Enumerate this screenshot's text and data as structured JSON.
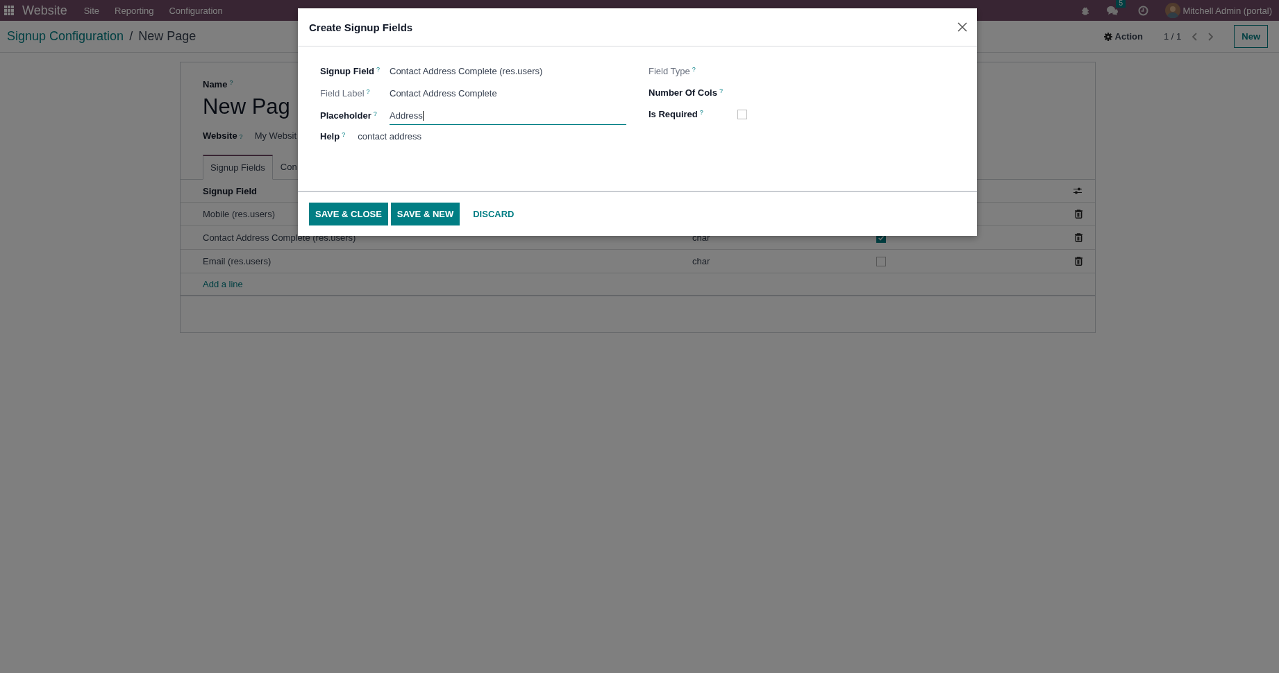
{
  "nav": {
    "app": "Website",
    "menus": [
      "Site",
      "Reporting",
      "Configuration"
    ],
    "message_count": "5",
    "user": "Mitchell Admin (portal)"
  },
  "breadcrumb": {
    "parent": "Signup Configuration",
    "separator": "/",
    "current": "New Page"
  },
  "control": {
    "action": "Action",
    "pager": "1 / 1",
    "new_label": "New"
  },
  "form": {
    "name_label": "Name",
    "name": "New Pag",
    "website_label": "Website",
    "website": "My Websit",
    "hint": "?"
  },
  "tabs": [
    {
      "label": "Signup Fields",
      "selected": true
    },
    {
      "label": "Con",
      "selected": false
    }
  ],
  "list": {
    "columns": [
      "Signup Field"
    ],
    "rows": [
      {
        "field": "Mobile (res.users)"
      },
      {
        "field": "Contact Address Complete (res.users)",
        "type": "char",
        "required": true
      },
      {
        "field": "Email (res.users)",
        "type": "char",
        "required": false
      }
    ],
    "add_line": "Add a line"
  },
  "dialog": {
    "title": "Create Signup Fields",
    "left": [
      {
        "label": "Signup Field",
        "hint": "?",
        "readonly": false,
        "kind": "text",
        "value": "Contact Address Complete (res.users)"
      },
      {
        "label": "Field Label",
        "hint": "?",
        "readonly": true,
        "kind": "text",
        "value": "Contact Address Complete"
      },
      {
        "label": "Placeholder",
        "hint": "?",
        "readonly": false,
        "kind": "input",
        "value": "Address"
      },
      {
        "label": "Help",
        "hint": "?",
        "readonly": false,
        "kind": "inline",
        "value": "contact address"
      }
    ],
    "right": [
      {
        "label": "Field Type",
        "hint": "?",
        "readonly": true,
        "kind": "empty"
      },
      {
        "label": "Number Of Cols",
        "hint": "?",
        "readonly": false,
        "kind": "empty"
      },
      {
        "label": "Is Required",
        "hint": "?",
        "readonly": false,
        "kind": "checkbox",
        "checked": false
      }
    ],
    "buttons": [
      {
        "label": "SAVE & CLOSE",
        "kind": "primary"
      },
      {
        "label": "SAVE & NEW",
        "kind": "primary"
      },
      {
        "label": "DISCARD",
        "kind": "link"
      }
    ]
  }
}
